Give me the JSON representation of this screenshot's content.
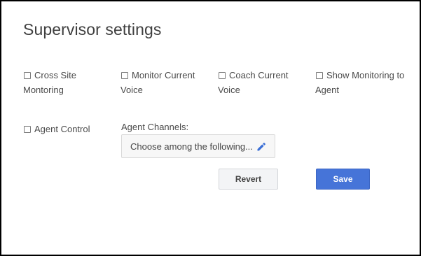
{
  "title": "Supervisor settings",
  "options": [
    {
      "label": "Cross Site Montoring",
      "checked": false
    },
    {
      "label": "Monitor Current Voice",
      "checked": false
    },
    {
      "label": "Coach Current Voice",
      "checked": false
    },
    {
      "label": "Show Monitoring to Agent",
      "checked": false
    },
    {
      "label": "Agent Control",
      "checked": false
    }
  ],
  "agent_channels": {
    "label": "Agent Channels:",
    "placeholder": "Choose among the following...",
    "icon": "pencil-icon"
  },
  "buttons": {
    "revert_label": "Revert",
    "save_label": "Save"
  },
  "colors": {
    "save_button": "#4674d8",
    "edit_icon": "#3b6fd6"
  }
}
